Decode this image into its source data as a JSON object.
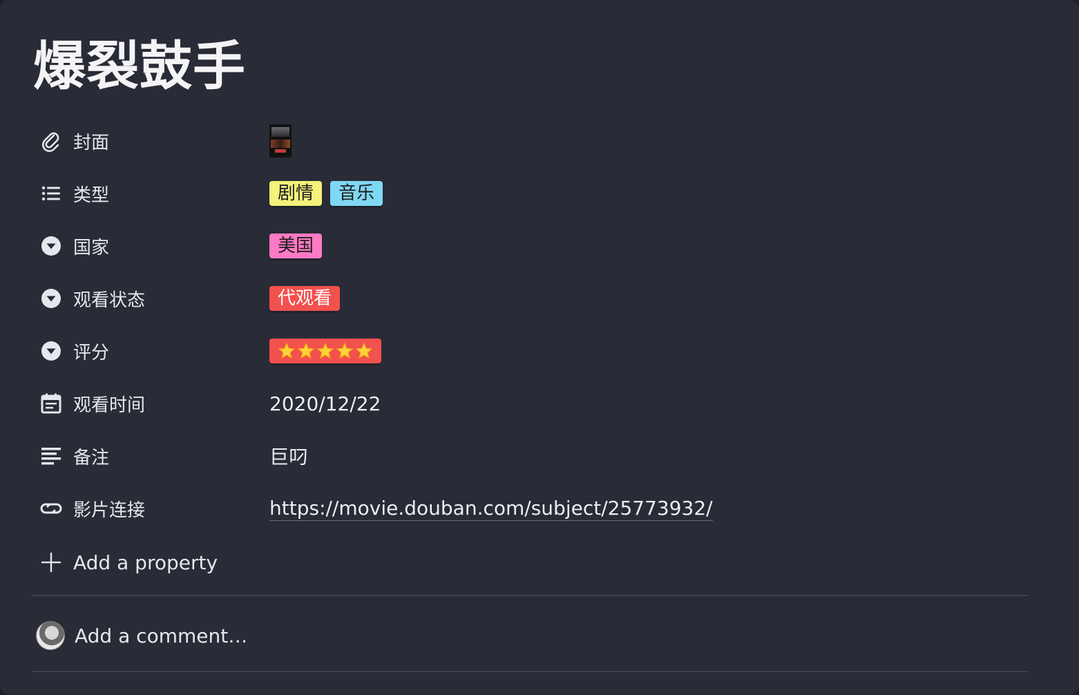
{
  "page": {
    "title": "爆裂鼓手"
  },
  "properties": {
    "cover": {
      "label": "封面",
      "icon": "paperclip-icon"
    },
    "genre": {
      "label": "类型",
      "icon": "list-icon",
      "tags": [
        {
          "text": "剧情",
          "color": "#f4f27a"
        },
        {
          "text": "音乐",
          "color": "#7fd8f3"
        }
      ]
    },
    "country": {
      "label": "国家",
      "icon": "select-icon",
      "tags": [
        {
          "text": "美国",
          "color": "#ff7ac4"
        }
      ]
    },
    "watch_status": {
      "label": "观看状态",
      "icon": "select-icon",
      "tags": [
        {
          "text": "代观看",
          "color": "#f2514e"
        }
      ]
    },
    "rating": {
      "label": "评分",
      "icon": "select-icon",
      "stars": 5,
      "max_stars": 5,
      "color": "#f2514e"
    },
    "watch_date": {
      "label": "观看时间",
      "icon": "calendar-icon",
      "value": "2020/12/22"
    },
    "notes": {
      "label": "备注",
      "icon": "text-icon",
      "value": "巨叼"
    },
    "film_link": {
      "label": "影片连接",
      "icon": "link-icon",
      "value": "https://movie.douban.com/subject/25773932/"
    }
  },
  "actions": {
    "add_property": "Add a property",
    "add_comment": "Add a comment…"
  },
  "colors": {
    "background": "#292b36",
    "divider": "#3d4152",
    "text": "#e9eaee"
  }
}
